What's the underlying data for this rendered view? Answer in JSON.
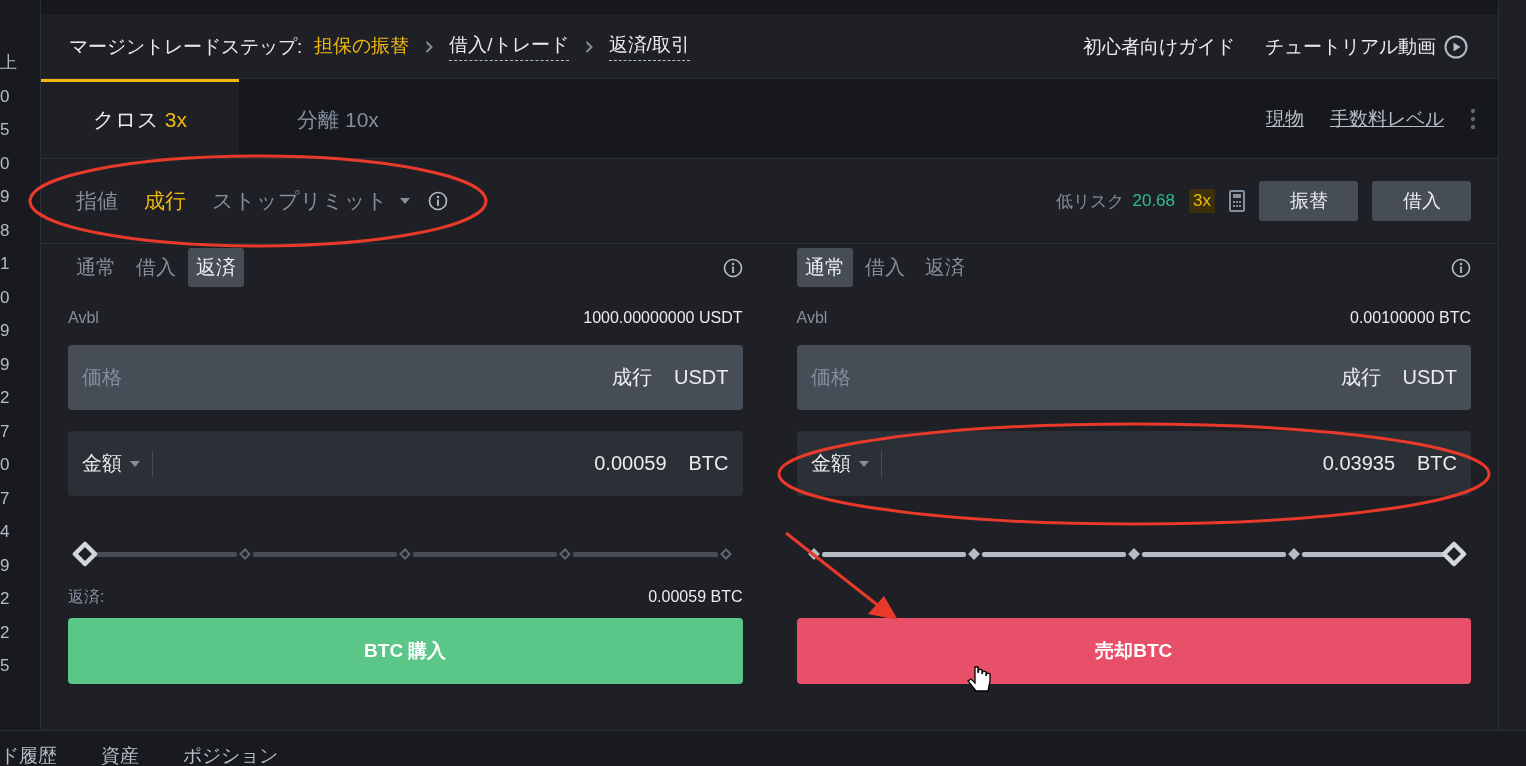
{
  "order_book_edge": [
    "上",
    "0",
    "5",
    "0",
    "9",
    "8",
    "1",
    "0",
    "9",
    "9",
    "2",
    "7",
    "0",
    "7",
    "4",
    "9",
    "2",
    "2",
    "5"
  ],
  "steps": {
    "label": "マージントレードステップ:",
    "items": [
      {
        "text": "担保の振替",
        "current": true
      },
      {
        "text": "借入/トレード",
        "current": false
      },
      {
        "text": "返済/取引",
        "current": false
      }
    ],
    "links": [
      "初心者向けガイド",
      "チュートリアル動画"
    ]
  },
  "margin_tabs": [
    {
      "label": "クロス",
      "leverage": "3x",
      "selected": true
    },
    {
      "label": "分離",
      "leverage": "10x",
      "selected": false
    }
  ],
  "margin_links": [
    "現物",
    "手数料レベル"
  ],
  "order_types": [
    {
      "label": "指値",
      "selected": false,
      "kind": "plain"
    },
    {
      "label": "成行",
      "selected": true,
      "kind": "plain"
    },
    {
      "label": "ストップリミット",
      "selected": false,
      "kind": "dropdown"
    }
  ],
  "risk": {
    "label": "低リスク",
    "value": "20.68",
    "leverage": "3x"
  },
  "actions": [
    "振替",
    "借入"
  ],
  "sides": [
    {
      "mode_tabs": [
        {
          "label": "通常",
          "selected": false
        },
        {
          "label": "借入",
          "selected": false
        },
        {
          "label": "返済",
          "selected": true
        }
      ],
      "avbl_label": "Avbl",
      "avbl_value": "1000.00000000 USDT",
      "price": {
        "placeholder": "価格",
        "type": "成行",
        "unit": "USDT"
      },
      "amount": {
        "label": "金額",
        "value": "0.00059",
        "unit": "BTC"
      },
      "slider": {
        "level": 0
      },
      "repay": {
        "label": "返済:",
        "value": "0.00059 BTC"
      },
      "button": {
        "label": "BTC 購入",
        "kind": "buy"
      }
    },
    {
      "mode_tabs": [
        {
          "label": "通常",
          "selected": true
        },
        {
          "label": "借入",
          "selected": false
        },
        {
          "label": "返済",
          "selected": false
        }
      ],
      "avbl_label": "Avbl",
      "avbl_value": "0.00100000 BTC",
      "price": {
        "placeholder": "価格",
        "type": "成行",
        "unit": "USDT"
      },
      "amount": {
        "label": "金額",
        "value": "0.03935",
        "unit": "BTC"
      },
      "slider": {
        "level": 1
      },
      "button": {
        "label": "売却BTC",
        "kind": "sell"
      }
    }
  ],
  "bottom_tabs": [
    "ド履歴",
    "資産",
    "ポジション"
  ]
}
